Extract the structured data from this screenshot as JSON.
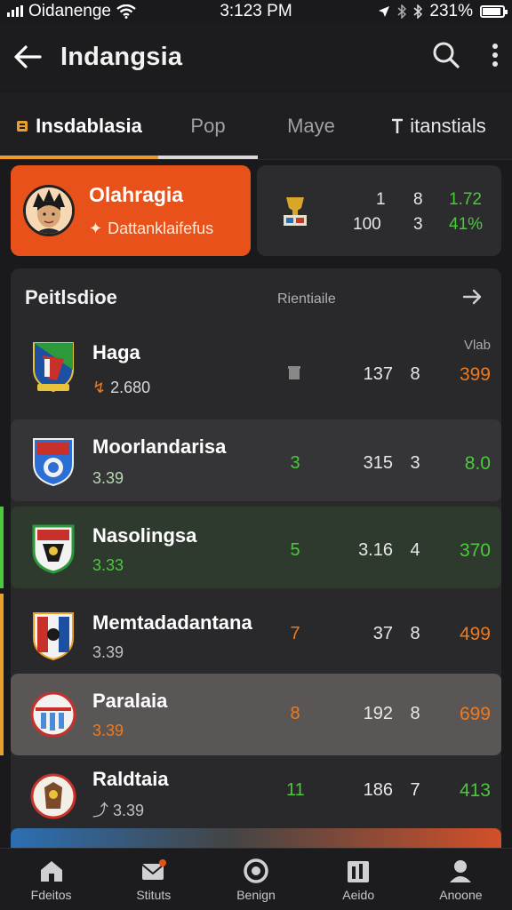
{
  "status_bar": {
    "carrier": "Oidanenge",
    "time": "3:123 PM",
    "battery": "231%",
    "battery_level": 0.9
  },
  "header": {
    "title": "Indangsia",
    "back_icon": "back-arrow-icon",
    "search_icon": "search-icon",
    "more_icon": "more-vertical-icon"
  },
  "tabs": [
    {
      "label": "Insdablasia",
      "active": true
    },
    {
      "label": "Pop",
      "active": false
    },
    {
      "label": "Maye",
      "active": false
    },
    {
      "label": "itanstials",
      "active": false
    }
  ],
  "highlight": {
    "name": "Olahragia",
    "subtitle": "Dattanklaifefus",
    "subtitle_icon": "spark-icon"
  },
  "stat_card": {
    "row1": {
      "a": "1",
      "b": "8",
      "c": "1.72"
    },
    "row2": {
      "a": "100",
      "b": "3",
      "c": "41%"
    }
  },
  "section": {
    "title": "Peitlsdioe",
    "meta": "Rientiaile",
    "arrow_icon": "arrow-right-icon",
    "rows": [
      {
        "name": "Haga",
        "sub": "2.680",
        "c1": "",
        "c2": "137",
        "c3": "8",
        "c4": "399",
        "extra": "Vlab"
      },
      {
        "name": "Moorlandarisa",
        "sub": "3.39",
        "c1": "3",
        "c2": "315",
        "c3": "3",
        "c4": "8.0",
        "extra": ""
      },
      {
        "name": "Nasolingsa",
        "sub": "3.33",
        "c1": "5",
        "c2": "3.16",
        "c3": "4",
        "c4": "370",
        "extra": ""
      },
      {
        "name": "Memtadadantana",
        "sub": "3.39",
        "c1": "7",
        "c2": "37",
        "c3": "8",
        "c4": "499",
        "extra": ""
      },
      {
        "name": "Paralaia",
        "sub": "3.39",
        "c1": "8",
        "c2": "192",
        "c3": "8",
        "c4": "699",
        "extra": ""
      },
      {
        "name": "Raldtaia",
        "sub": "3.39",
        "c1": "11",
        "c2": "186",
        "c3": "7",
        "c4": "413",
        "extra": ""
      }
    ]
  },
  "bottom_nav": [
    {
      "label": "Fdeitos",
      "icon": "home-icon"
    },
    {
      "label": "Stituts",
      "icon": "mail-icon"
    },
    {
      "label": "Benign",
      "icon": "target-icon"
    },
    {
      "label": "Aeido",
      "icon": "stats-icon"
    },
    {
      "label": "Anoone",
      "icon": "profile-icon"
    }
  ],
  "colors": {
    "accent": "#e8521a",
    "green": "#4ac93a",
    "orange": "#ee7a1e"
  }
}
